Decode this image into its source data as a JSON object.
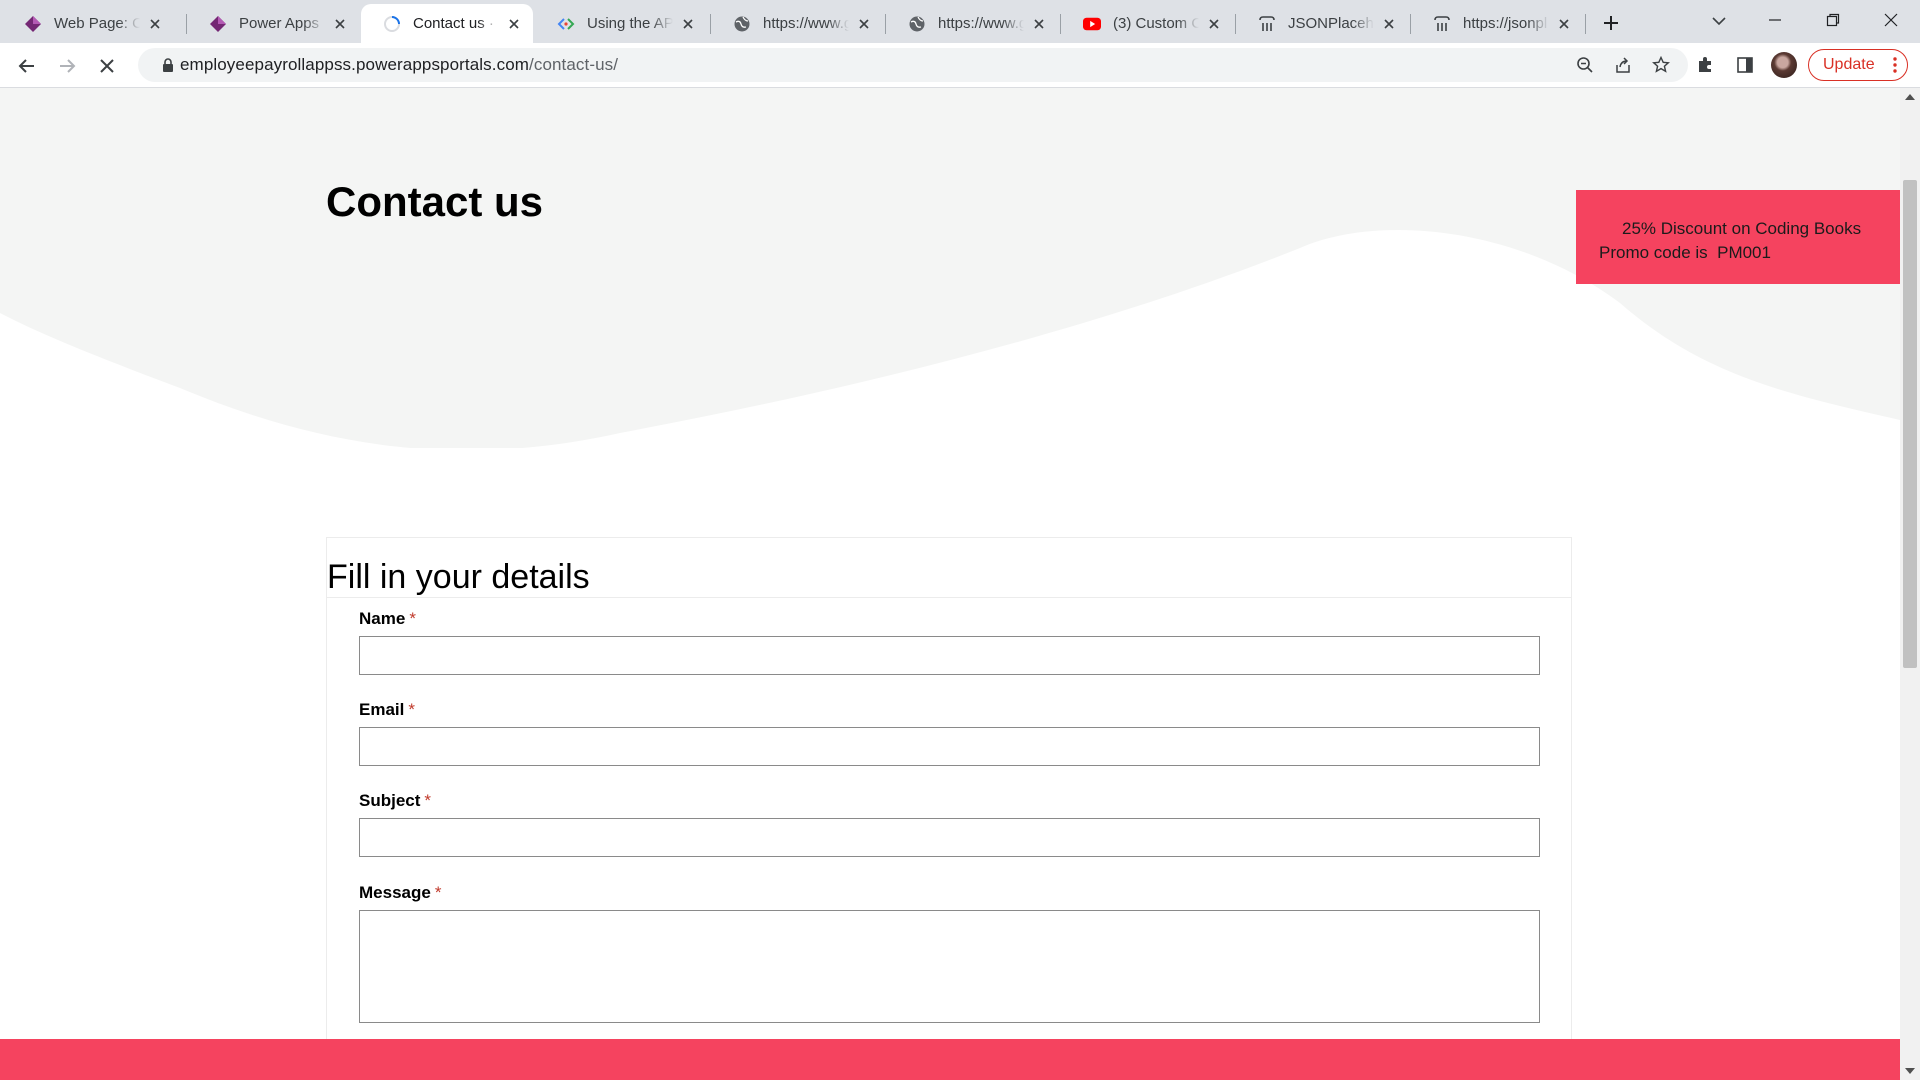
{
  "browser": {
    "tabs": [
      {
        "title": "Web Page: Co",
        "icon": "power-apps-icon",
        "active": false
      },
      {
        "title": "Power Apps",
        "icon": "power-apps-icon",
        "active": false
      },
      {
        "title": "Contact us · S",
        "icon": "loading-spinner-icon",
        "active": true
      },
      {
        "title": "Using the API",
        "icon": "api-explorer-icon",
        "active": false
      },
      {
        "title": "https://www.g",
        "icon": "globe-icon",
        "active": false
      },
      {
        "title": "https://www.g",
        "icon": "globe-icon",
        "active": false
      },
      {
        "title": "(3) Custom Co",
        "icon": "youtube-icon",
        "active": false
      },
      {
        "title": "JSONPlacehol",
        "icon": "jsonplaceholder-icon",
        "active": false
      },
      {
        "title": "https://jsonpl",
        "icon": "jsonplaceholder-icon",
        "active": false
      }
    ],
    "url_host": "employeepayrollappss.powerappsportals.com",
    "url_path": "/contact-us/",
    "update_label": "Update",
    "accent_color": "#d93025"
  },
  "page": {
    "title": "Contact us",
    "promo": {
      "line1": "25% Discount on Coding Books",
      "line2": "Promo code is  PM001",
      "background": "#f5435f"
    },
    "form": {
      "heading": "Fill in your details",
      "required_marker": "*",
      "fields": [
        {
          "label": "Name",
          "value": ""
        },
        {
          "label": "Email",
          "value": ""
        },
        {
          "label": "Subject",
          "value": ""
        },
        {
          "label": "Message",
          "value": ""
        }
      ]
    }
  }
}
